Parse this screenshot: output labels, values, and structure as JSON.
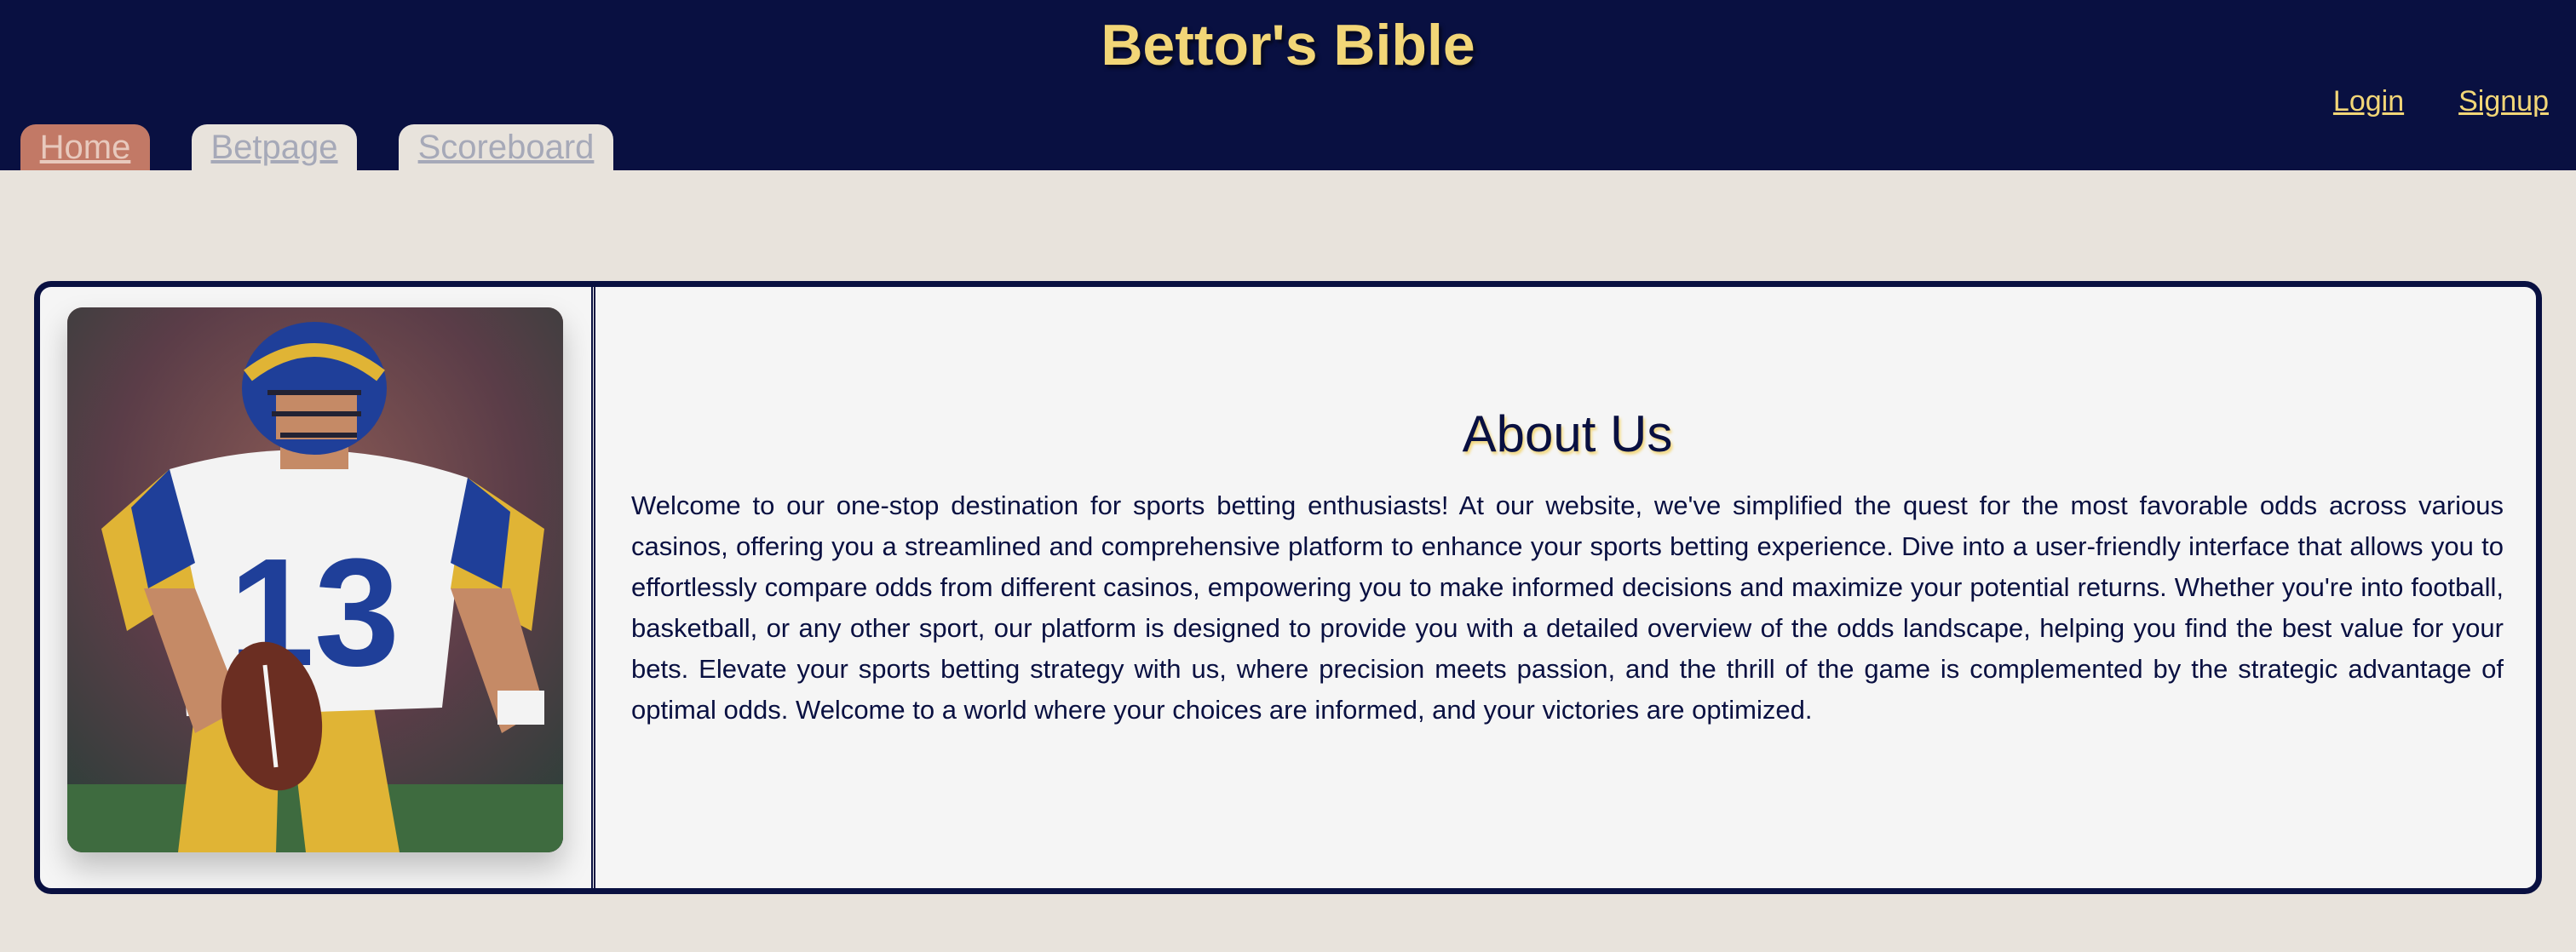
{
  "header": {
    "title": "Bettor's Bible",
    "tabs": [
      {
        "label": "Home",
        "active": true
      },
      {
        "label": "Betpage",
        "active": false
      },
      {
        "label": "Scoreboard",
        "active": false
      }
    ],
    "auth": {
      "login_label": "Login",
      "signup_label": "Signup"
    }
  },
  "about": {
    "heading": "About Us",
    "body": "Welcome to our one-stop destination for sports betting enthusiasts! At our website, we've simplified the quest for the most favorable odds across various casinos, offering you a streamlined and comprehensive platform to enhance your sports betting experience. Dive into a user-friendly interface that allows you to effortlessly compare odds from different casinos, empowering you to make informed decisions and maximize your potential returns. Whether you're into football, basketball, or any other sport, our platform is designed to provide you with a detailed overview of the odds landscape, helping you find the best value for your bets. Elevate your sports betting strategy with us, where precision meets passion, and the thrill of the game is complemented by the strategic advantage of optimal odds. Welcome to a world where your choices are informed, and your victories are optimized."
  },
  "colors": {
    "header_bg": "#091041",
    "title": "#f2d677",
    "active_tab": "#c27966",
    "page_bg": "#e8e3dc",
    "card_bg": "#f5f5f5"
  }
}
